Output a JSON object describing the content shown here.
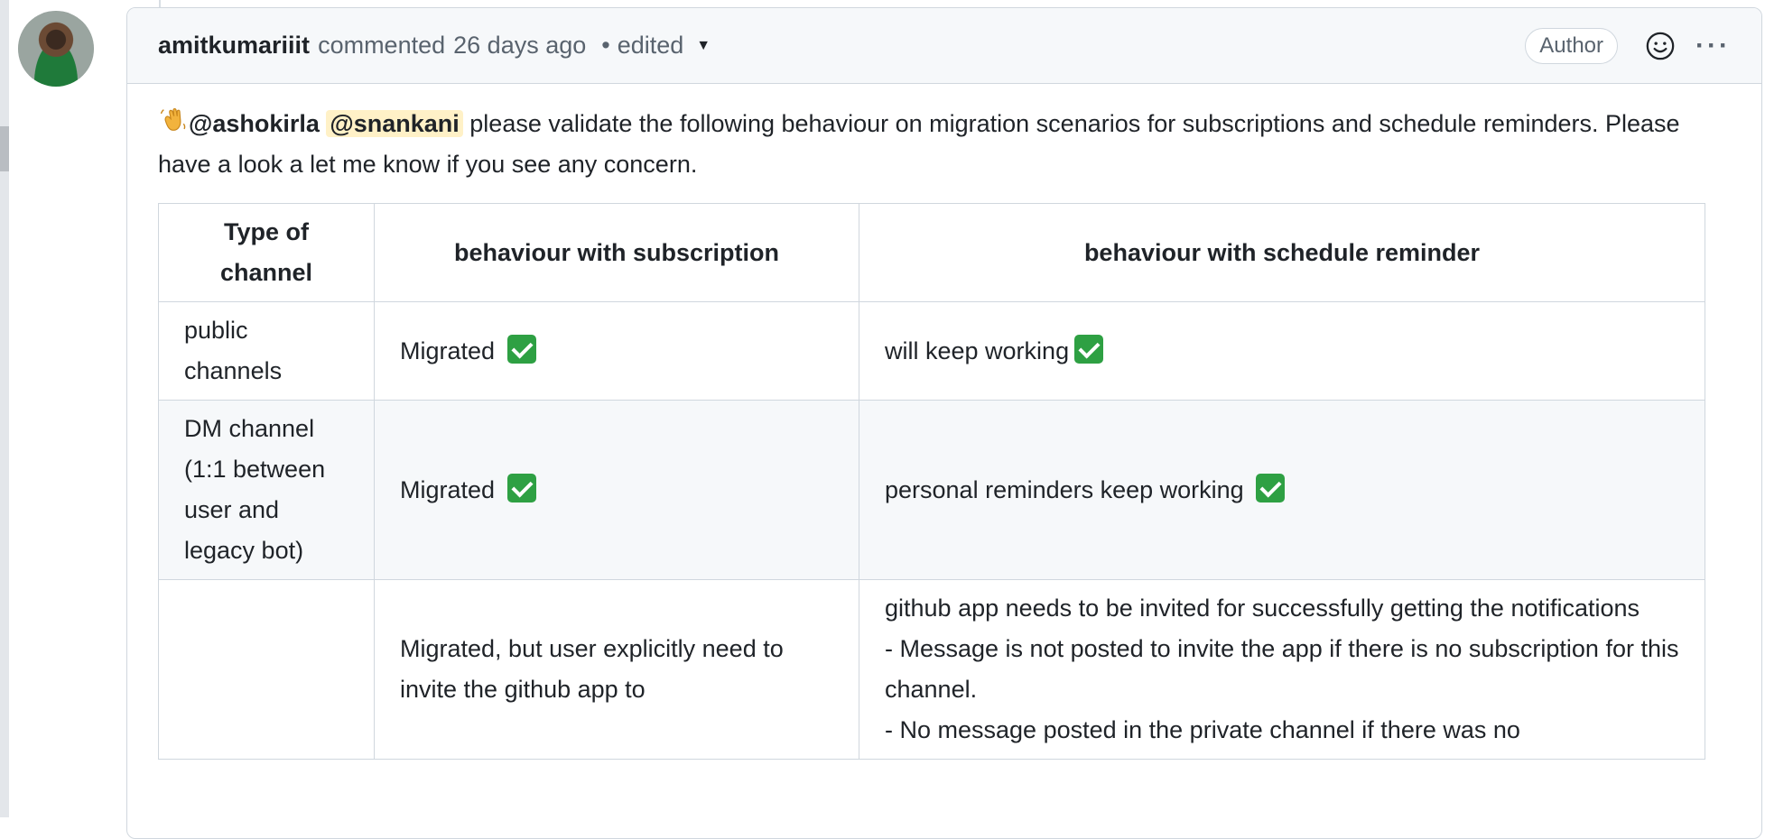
{
  "comment": {
    "author": "amitkumariiit",
    "action": "commented",
    "time": "26 days ago",
    "dot": "•",
    "edited": "edited",
    "badge": "Author",
    "more": "···",
    "greeting_icon": "waving-hand-icon",
    "mention_1": "@ashokirla",
    "mention_2": "@snankani",
    "body_text": " please validate the following behaviour on migration scenarios for subscriptions and schedule reminders. Please have a look a let me know if you see any concern."
  },
  "table": {
    "headers": [
      "Type of channel",
      "behaviour with subscription",
      "behaviour with schedule reminder"
    ],
    "rows": [
      {
        "type": "public channels",
        "subscription": "Migrated",
        "reminder": "will keep working"
      },
      {
        "type": "DM channel (1:1 between user and legacy bot)",
        "subscription": "Migrated",
        "reminder": "personal reminders keep working"
      },
      {
        "type": "",
        "subscription": "Migrated, but user explicitly need to invite the github app to",
        "reminder_line1": "github app needs to be invited for successfully getting the notifications",
        "reminder_line2": "- Message is not posted to invite the app if there is no subscription for this channel.",
        "reminder_line3": "- No message posted in the private channel if there was no"
      }
    ]
  },
  "colors": {
    "check": "#2ea043",
    "mention_highlight": "#fff1c7",
    "header_bg": "#f6f8fa"
  }
}
